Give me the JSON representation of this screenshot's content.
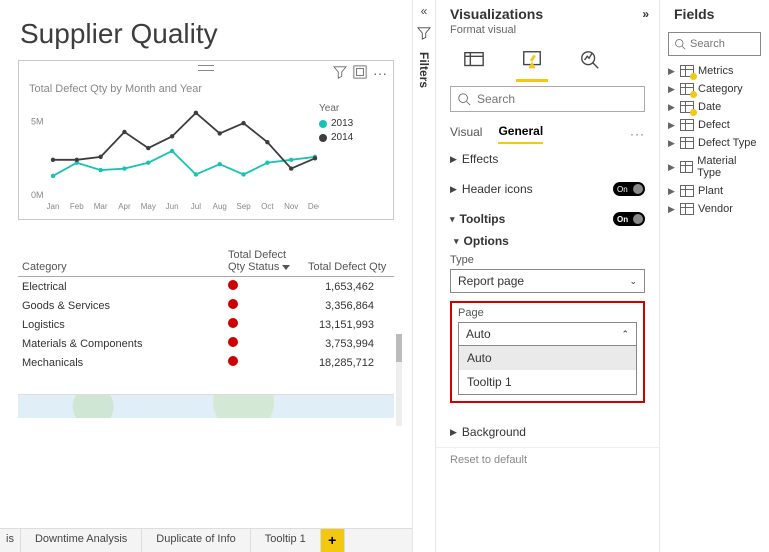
{
  "page_title": "Supplier Quality",
  "chart_data": {
    "type": "line",
    "title": "Total Defect Qty by Month and Year",
    "legend_title": "Year",
    "xlabel": "",
    "ylabel": "",
    "ylim": [
      0,
      6000000
    ],
    "yticks_labels": [
      "0M",
      "5M"
    ],
    "categories": [
      "Jan",
      "Feb",
      "Mar",
      "Apr",
      "May",
      "Jun",
      "Jul",
      "Aug",
      "Sep",
      "Oct",
      "Nov",
      "Dec"
    ],
    "series": [
      {
        "name": "2013",
        "color": "#17c3b2",
        "values": [
          1300000,
          2200000,
          1700000,
          1800000,
          2200000,
          3000000,
          1400000,
          2100000,
          1400000,
          2200000,
          2400000,
          2600000
        ]
      },
      {
        "name": "2014",
        "color": "#3d3d3d",
        "values": [
          2400000,
          2400000,
          2600000,
          4300000,
          3200000,
          4000000,
          5600000,
          4200000,
          4900000,
          3600000,
          1800000,
          2500000
        ]
      }
    ]
  },
  "table": {
    "columns": [
      "Category",
      "Total Defect Qty Status",
      "Total Defect Qty"
    ],
    "rows": [
      {
        "category": "Electrical",
        "qty": "1,653,462"
      },
      {
        "category": "Goods & Services",
        "qty": "3,356,864"
      },
      {
        "category": "Logistics",
        "qty": "13,151,993"
      },
      {
        "category": "Materials & Components",
        "qty": "3,753,994"
      },
      {
        "category": "Mechanicals",
        "qty": "18,285,712"
      }
    ]
  },
  "tabs": {
    "trunc": "is",
    "items": [
      "Downtime Analysis",
      "Duplicate of Info",
      "Tooltip 1"
    ],
    "add": "+"
  },
  "filters_label": "Filters",
  "viz_panel": {
    "title": "Visualizations",
    "subtitle": "Format visual",
    "search_placeholder": "Search",
    "subtabs": {
      "visual": "Visual",
      "general": "General"
    },
    "sections": {
      "effects": "Effects",
      "header_icons": "Header icons",
      "tooltips": "Tooltips",
      "options": "Options",
      "background": "Background",
      "reset": "Reset to default"
    },
    "toggle_label": "On",
    "type": {
      "label": "Type",
      "value": "Report page"
    },
    "page": {
      "label": "Page",
      "value": "Auto",
      "options": [
        "Auto",
        "Tooltip 1"
      ]
    }
  },
  "fields_panel": {
    "title": "Fields",
    "search_placeholder": "Search",
    "tables": [
      {
        "name": "Metrics",
        "badge": true
      },
      {
        "name": "Category",
        "badge": true
      },
      {
        "name": "Date",
        "badge": true
      },
      {
        "name": "Defect",
        "badge": false
      },
      {
        "name": "Defect Type",
        "badge": false
      },
      {
        "name": "Material Type",
        "badge": false
      },
      {
        "name": "Plant",
        "badge": false
      },
      {
        "name": "Vendor",
        "badge": false
      }
    ]
  }
}
